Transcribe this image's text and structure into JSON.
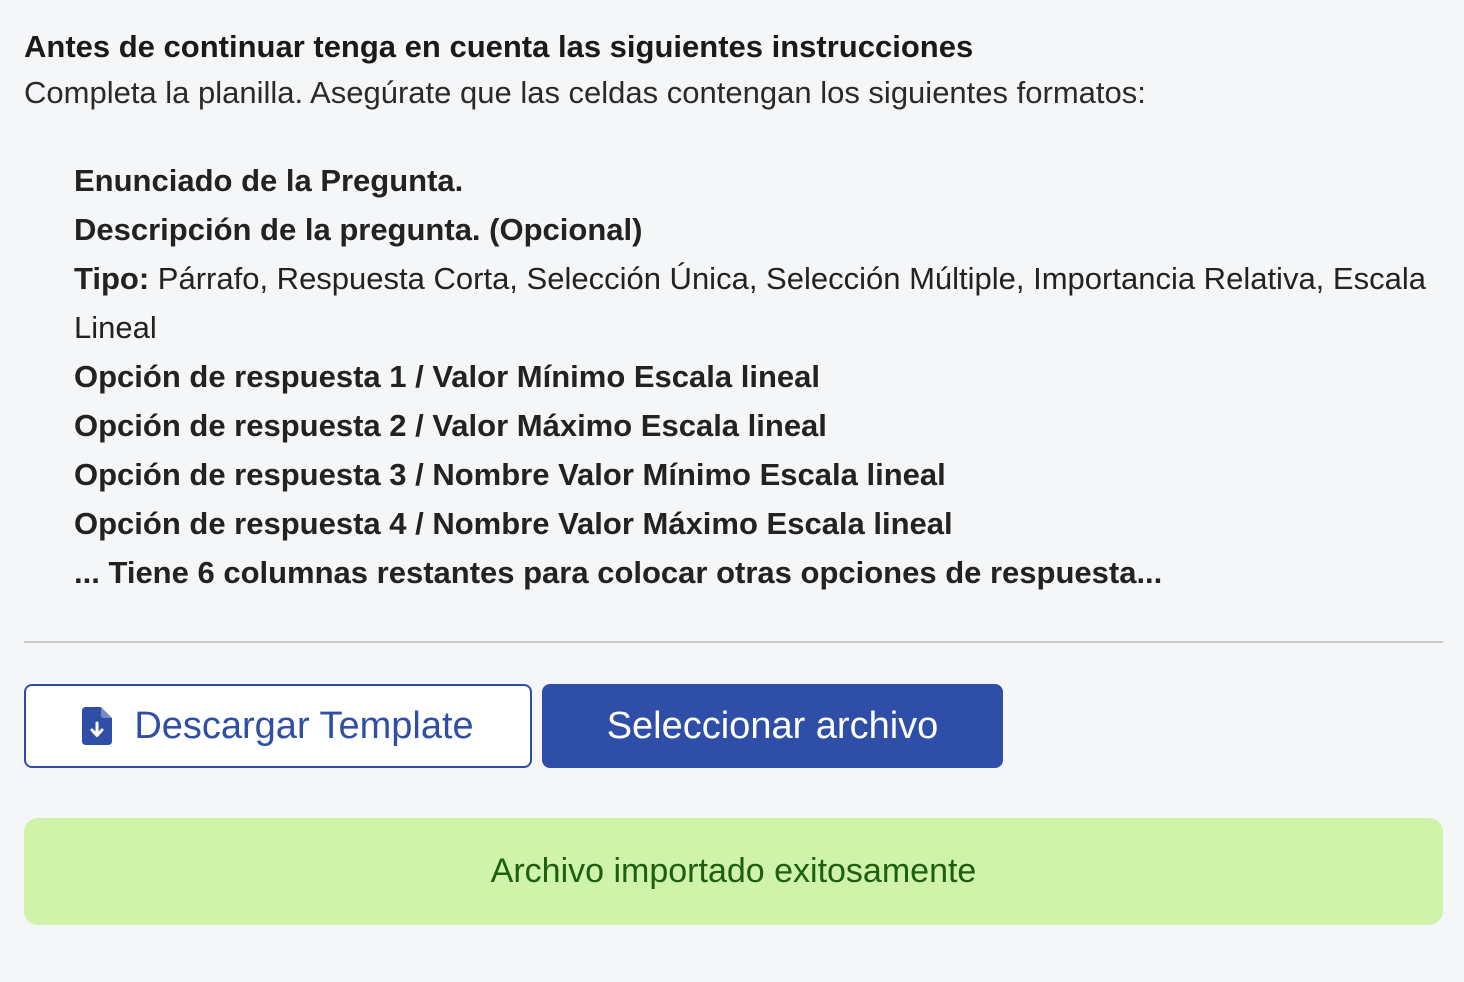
{
  "instructions": {
    "heading": "Antes de continuar tenga en cuenta las siguientes instrucciones",
    "intro": "Completa la planilla. Asegúrate que las celdas contengan los siguientes formatos:",
    "items": {
      "enunciado": "Enunciado de la Pregunta.",
      "descripcion": "Descripción de la pregunta. (Opcional)",
      "tipo_label": "Tipo:",
      "tipo_values": " Párrafo, Respuesta Corta, Selección Única, Selección Múltiple, Importancia Relativa, Escala Lineal",
      "opcion1": "Opción de respuesta 1 / Valor Mínimo Escala lineal",
      "opcion2": "Opción de respuesta 2 / Valor Máximo Escala lineal",
      "opcion3": "Opción de respuesta 3 / Nombre Valor Mínimo Escala lineal",
      "opcion4": "Opción de respuesta 4 / Nombre Valor Máximo Escala lineal",
      "restantes": "... Tiene 6 columnas restantes para colocar otras opciones de respuesta..."
    }
  },
  "actions": {
    "download_label": "Descargar Template",
    "download_icon": "file-download-icon",
    "select_label": "Seleccionar archivo"
  },
  "status": {
    "success_message": "Archivo importado exitosamente"
  },
  "colors": {
    "accent": "#2f4ea8",
    "success_bg": "#cff3a9",
    "success_text": "#1d5e12",
    "background": "#f5f6f8"
  }
}
